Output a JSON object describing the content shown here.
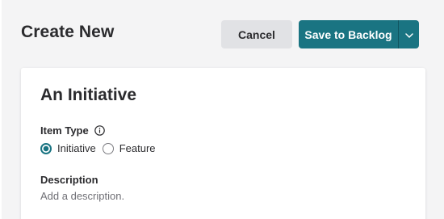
{
  "header": {
    "title": "Create New",
    "cancel_label": "Cancel",
    "save_label": "Save to Backlog"
  },
  "form": {
    "title": "An Initiative",
    "item_type_label": "Item Type",
    "item_type_options": [
      {
        "label": "Initiative",
        "selected": true
      },
      {
        "label": "Feature",
        "selected": false
      }
    ],
    "description_label": "Description",
    "description_placeholder": "Add a description."
  },
  "colors": {
    "accent": "#1a7482",
    "cancel_bg": "#e1e2e5",
    "page_bg": "#f4f4f5",
    "text": "#2b2b2e",
    "muted_text": "#6f6f75"
  },
  "icons": {
    "info": "info-icon",
    "dropdown": "chevron-down-icon"
  }
}
